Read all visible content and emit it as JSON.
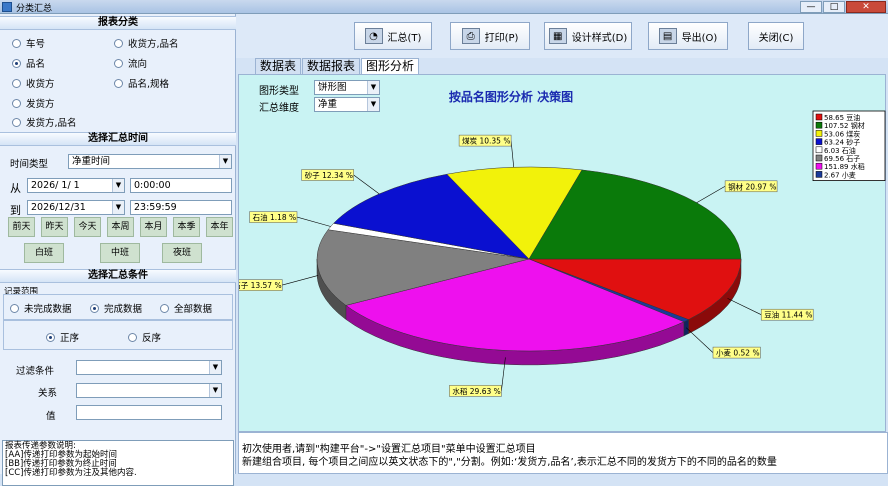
{
  "window": {
    "title": "分类汇总",
    "min": "—",
    "max": "□",
    "close": "✕"
  },
  "left": {
    "section1": "报表分类",
    "report_options": [
      {
        "label": "车号",
        "checked": false
      },
      {
        "label": "收货方,品名",
        "checked": false
      },
      {
        "label": "品名",
        "checked": true
      },
      {
        "label": "流向",
        "checked": false
      },
      {
        "label": "收货方",
        "checked": false
      },
      {
        "label": "品名,规格",
        "checked": false
      },
      {
        "label": "发货方",
        "checked": false
      },
      {
        "label": "发货方,品名",
        "checked": false
      }
    ],
    "section2": "选择汇总时间",
    "time_type_label": "时间类型",
    "time_type_value": "净重时间",
    "from_label": "从",
    "from_date": "2026/ 1/ 1",
    "from_time": "0:00:00",
    "to_label": "到",
    "to_date": "2026/12/31",
    "to_time": "23:59:59",
    "quick_row1": [
      "前天",
      "昨天",
      "今天",
      "本周",
      "本月",
      "本季",
      "本年"
    ],
    "quick_row2": [
      "白班",
      "中班",
      "夜班"
    ],
    "section3": "选择汇总条件",
    "record_range_label": "记录范围",
    "record_options": [
      {
        "label": "未完成数据",
        "checked": false
      },
      {
        "label": "完成数据",
        "checked": true
      },
      {
        "label": "全部数据",
        "checked": false
      }
    ],
    "order_options": [
      {
        "label": "正序",
        "checked": true
      },
      {
        "label": "反序",
        "checked": false
      }
    ],
    "filter_label": "过滤条件",
    "relation_label": "关系",
    "value_label": "值",
    "notes": [
      "报表传递参数说明:",
      "[AA]传递打印参数为起始时间",
      "[BB]传递打印参数为终止时间",
      "[CC]传递打印参数为注及其他内容."
    ]
  },
  "toolbar": {
    "summary": "汇总(T)",
    "print": "打印(P)",
    "design": "设计样式(D)",
    "export": "导出(O)",
    "close": "关闭(C)"
  },
  "tabs": [
    {
      "label": "数据表",
      "active": false
    },
    {
      "label": "数据报表",
      "active": false
    },
    {
      "label": "图形分析",
      "active": true
    }
  ],
  "chart_controls": {
    "type_label": "图形类型",
    "type_value": "饼形图",
    "dim_label": "汇总维度",
    "dim_value": "净重"
  },
  "chart_data": {
    "type": "pie",
    "title": "按品名图形分析 决策图",
    "slices": [
      {
        "name": "豆油",
        "value": 58.65,
        "label": "豆油 11.44 %",
        "color": "#e01010"
      },
      {
        "name": "小麦",
        "value": 2.67,
        "label": "小麦 0.52 %",
        "color": "#1a3a9a"
      },
      {
        "name": "水稻",
        "value": 151.89,
        "label": "水稻 29.63 %",
        "color": "#ee10ee"
      },
      {
        "name": "石子",
        "value": 69.56,
        "label": "石子 13.57 %",
        "color": "#808080"
      },
      {
        "name": "石油",
        "value": 6.03,
        "label": "石油 1.18 %",
        "color": "#ffffff"
      },
      {
        "name": "砂子",
        "value": 63.24,
        "label": "砂子 12.34 %",
        "color": "#0a10d0"
      },
      {
        "name": "煤炭",
        "value": 53.06,
        "label": "煤炭 10.35 %",
        "color": "#f2f20a"
      },
      {
        "name": "钢材",
        "value": 107.52,
        "label": "钢材 20.97 %",
        "color": "#0a7a0a"
      }
    ],
    "legend": [
      {
        "text": "58.65 豆油",
        "color": "#e01010"
      },
      {
        "text": "107.52 钢材",
        "color": "#0a7a0a"
      },
      {
        "text": "53.06 煤炭",
        "color": "#f2f20a"
      },
      {
        "text": "63.24 砂子",
        "color": "#0a10d0"
      },
      {
        "text": "6.03 石油",
        "color": "#ffffff"
      },
      {
        "text": "69.56 石子",
        "color": "#808080"
      },
      {
        "text": "151.89 水稻",
        "color": "#ee10ee"
      },
      {
        "text": "2.67 小麦",
        "color": "#1a3a9a"
      }
    ],
    "legend_placement": "top-right"
  },
  "hint_lines": [
    "初次使用者,请到\"构建平台\"->\"设置汇总项目\"菜单中设置汇总项目",
    "新建组合项目, 每个项目之间应以英文状态下的\",\"分割。例如:‘发货方,品名’,表示汇总不同的发货方下的不同的品名的数量"
  ]
}
